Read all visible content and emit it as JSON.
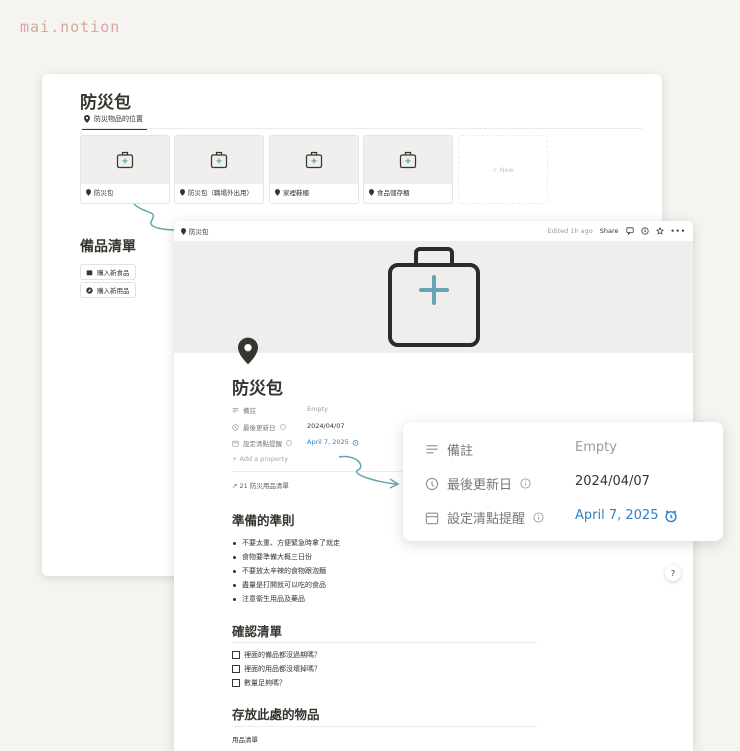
{
  "brand": "mai.notion",
  "background_page": {
    "title": "防災包",
    "tab": "防災物品的位置",
    "gallery": [
      {
        "label": "防災包"
      },
      {
        "label": "防災包（職場外出用）"
      },
      {
        "label": "家裡鞋櫃"
      },
      {
        "label": "食品儲存櫃"
      }
    ],
    "new_label": "+ New",
    "section_title": "備品清單",
    "buttons": [
      "購入新食品",
      "購入新用品"
    ]
  },
  "page": {
    "breadcrumb": "防災包",
    "edited": "Edited 1h ago",
    "share": "Share",
    "title": "防災包",
    "props": [
      {
        "name": "備註",
        "value": "Empty",
        "icon": "text-lines-icon"
      },
      {
        "name": "最後更新日",
        "value": "2024/04/07",
        "icon": "clock-icon"
      },
      {
        "name": "設定清點提醒",
        "value": "April 7, 2025",
        "icon": "calendar-icon"
      }
    ],
    "add_property": "+ Add a property",
    "relation": "↗ 21 防災用品清單",
    "section1": "準備的準則",
    "bullets": [
      "不要太重、方便緊急時拿了就走",
      "食物要準備大概三日份",
      "不要放太辛辣的食物跟泡麵",
      "盡量是打開就可以吃的食品",
      "注意衛生用品及藥品"
    ],
    "section2": "確認清單",
    "checks": [
      "裡面的備品都沒過期嗎？",
      "裡面的用品都沒壞掉嗎？",
      "數量足夠嗎？"
    ],
    "section3": "存放此處的物品",
    "bottom_item": "用品清單"
  },
  "zoom": {
    "props": [
      {
        "name": "備註",
        "value": "Empty"
      },
      {
        "name": "最後更新日",
        "value": "2024/04/07"
      },
      {
        "name": "設定清點提醒",
        "value": "April 7, 2025"
      }
    ]
  },
  "help": "?",
  "colors": {
    "accent": "#2f80c9",
    "teal": "#62a6b0",
    "brand": "#d9a79f"
  }
}
